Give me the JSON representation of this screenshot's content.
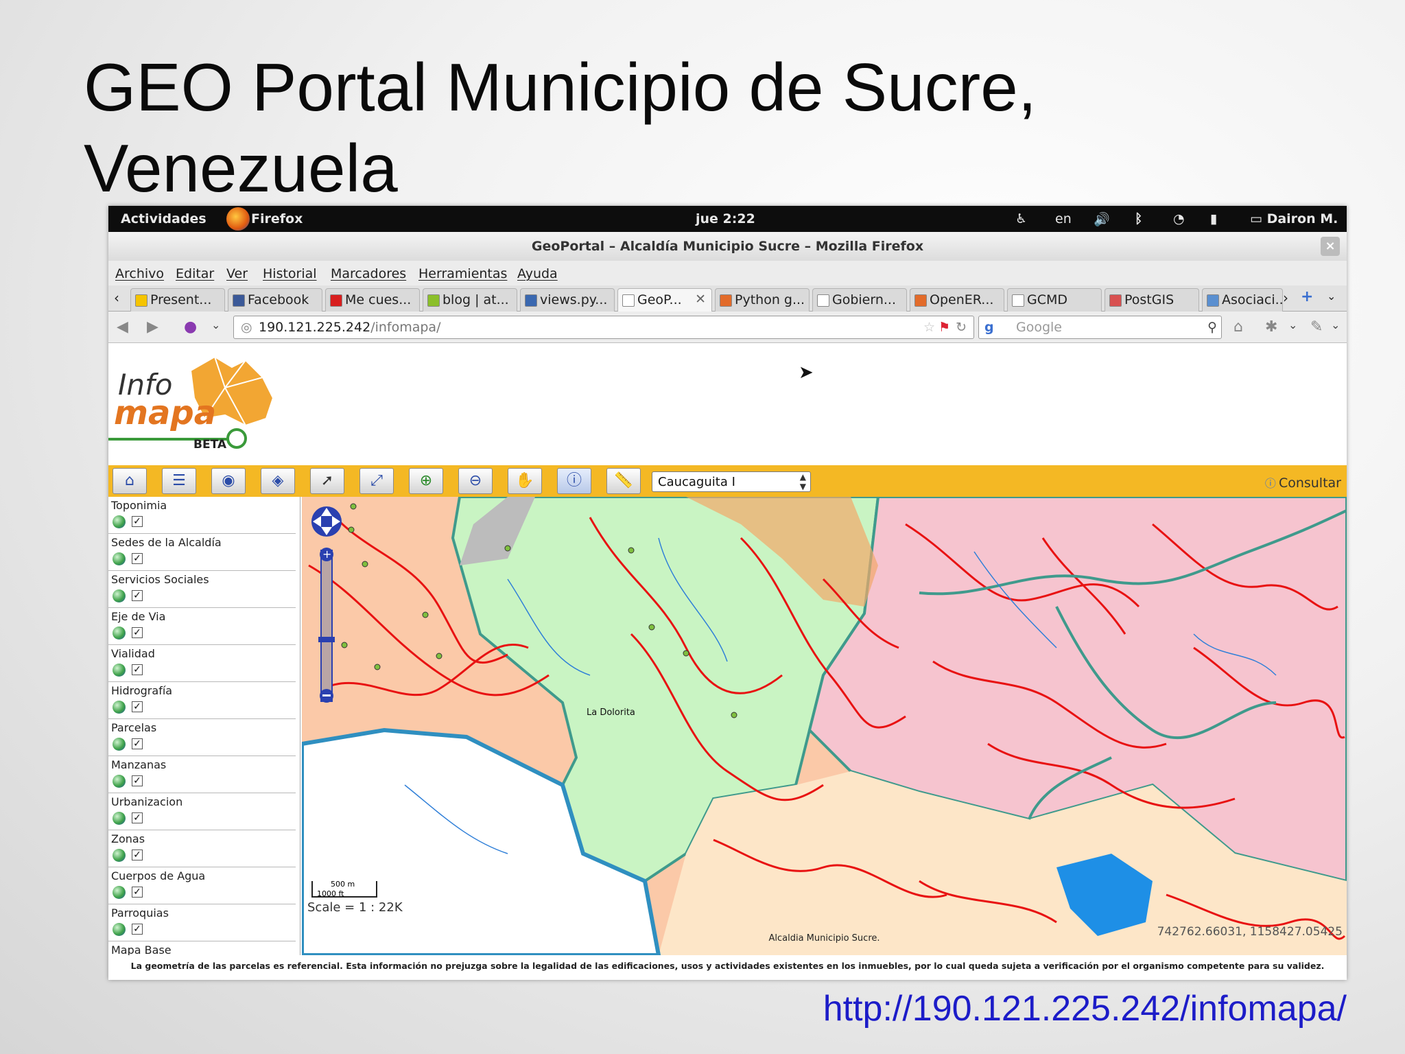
{
  "slide": {
    "title_line1": "GEO Portal Municipio de Sucre,",
    "title_line2": "Venezuela",
    "url": "http://190.121.225.242/infomapa/"
  },
  "desktop": {
    "activities": "Actividades",
    "app_name": "Firefox",
    "clock": "jue 2:22",
    "lang": "en",
    "user": "Dairon M."
  },
  "window": {
    "title": "GeoPortal – Alcaldía Municipio Sucre – Mozilla Firefox",
    "close": "×"
  },
  "menu": [
    "Archivo",
    "Editar",
    "Ver",
    "Historial",
    "Marcadores",
    "Herramientas",
    "Ayuda"
  ],
  "tabs": [
    {
      "label": "Present...",
      "color": "#f5c400"
    },
    {
      "label": "Facebook",
      "color": "#3b5998"
    },
    {
      "label": "Me cues...",
      "color": "#d81f1f"
    },
    {
      "label": "blog | at...",
      "color": "#8bbf2a"
    },
    {
      "label": "views.py...",
      "color": "#3a68b0"
    },
    {
      "label": "GeoP...",
      "color": "#ffffff",
      "active": true
    },
    {
      "label": "Python g...",
      "color": "#e26b2a"
    },
    {
      "label": "Gobiern...",
      "color": "#ffffff"
    },
    {
      "label": "OpenER...",
      "color": "#e26b2a"
    },
    {
      "label": "GCMD",
      "color": "#ffffff"
    },
    {
      "label": "PostGIS",
      "color": "#d85050"
    },
    {
      "label": "Asociaci...",
      "color": "#5a8fd0"
    }
  ],
  "nav": {
    "url_host": "190.121.225.242",
    "url_path": "/infomapa/",
    "search_placeholder": "Google"
  },
  "logo": {
    "info": "Info",
    "mapa": "mapa",
    "beta": "BETA"
  },
  "toolbar": {
    "selected_place": "Caucaguita I",
    "consultar": "Consultar",
    "tools": [
      "home-icon",
      "layer-list-icon",
      "hide-layers-icon",
      "show-layers-icon",
      "pointer-icon",
      "zoom-extent-icon",
      "zoom-in-icon",
      "zoom-out-icon",
      "pan-hand-icon",
      "identify-icon",
      "measure-icon"
    ]
  },
  "layers": [
    "Toponimia",
    "Sedes de la Alcaldía",
    "Servicios Sociales",
    "Eje de Via",
    "Vialidad",
    "Hidrografía",
    "Parcelas",
    "Manzanas",
    "Urbanizacion",
    "Zonas",
    "Cuerpos de Agua",
    "Parroquias",
    "Mapa Base"
  ],
  "map": {
    "place_label": "La Dolorita",
    "scale_m": "500 m",
    "scale_ft": "1000 ft",
    "scale_text": "Scale = 1 : 22K",
    "coords": "742762.66031, 1158427.05425",
    "attribution": "Alcaldia Municipio Sucre.",
    "colors": {
      "parcel_orange": "#fbc9a8",
      "zone_green": "#c9f4c3",
      "zone_pink": "#f6c4cf",
      "zone_cream": "#fde6c8",
      "roads": "#e81212",
      "rivers": "#2f7fd8",
      "parroquia_border": "#3f9a8c",
      "water_body": "#1e8fe6"
    }
  },
  "footer_note": "La geometría de las parcelas es referencial. Esta información no prejuzga sobre la legalidad de las edificaciones, usos y actividades existentes en los inmuebles, por lo cual queda sujeta a verificación por el organismo competente para su validez."
}
